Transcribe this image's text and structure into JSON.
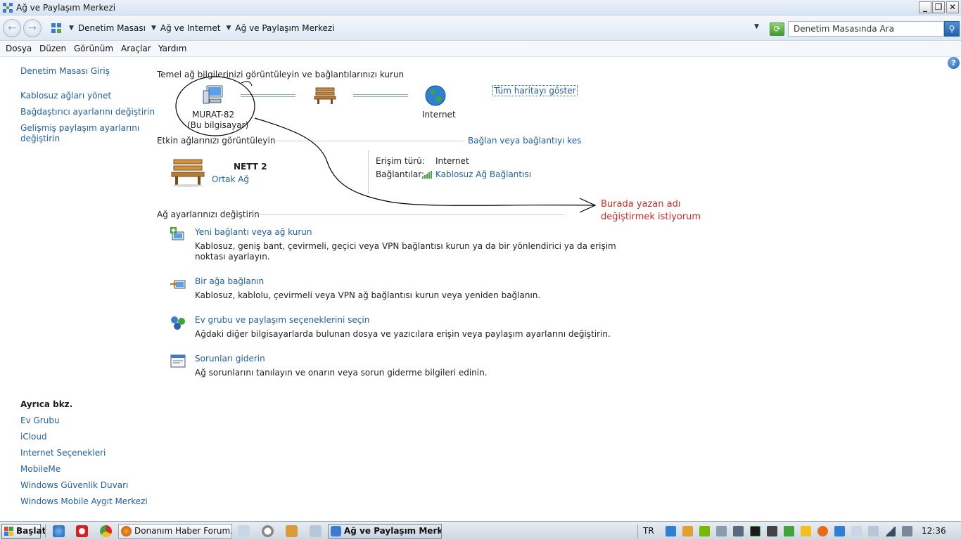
{
  "window": {
    "title": "Ağ ve Paylaşım Merkezi"
  },
  "address": {
    "crumbs": [
      "Denetim Masası",
      "Ağ ve Internet",
      "Ağ ve Paylaşım Merkezi"
    ],
    "search_placeholder": "Denetim Masasında Ara"
  },
  "menu": [
    "Dosya",
    "Düzen",
    "Görünüm",
    "Araçlar",
    "Yardım"
  ],
  "sidebar": {
    "top_links": [
      "Denetim Masası Giriş",
      "Kablosuz ağları yönet",
      "Bağdaştırıcı ayarlarını değiştirin",
      "Gelişmiş paylaşım ayarlarını",
      "değiştirin"
    ],
    "see_also_title": "Ayrıca bkz.",
    "see_also": [
      "Ev Grubu",
      "iCloud",
      "Internet Seçenekleri",
      "MobileMe",
      "Windows Güvenlik Duvarı",
      "Windows Mobile Aygıt Merkezi"
    ]
  },
  "main": {
    "basic_heading": "Temel ağ bilgilerinizi görüntüleyin ve bağlantılarınızı kurun",
    "computer_name": "MURAT-82",
    "computer_sub": "(Bu bilgisayar)",
    "internet_label": "Internet",
    "full_map": "Tüm haritayı göster",
    "active_heading": "Etkin ağlarınızı görüntüleyin",
    "connect_link": "Bağlan veya bağlantıyı kes",
    "network_name": "NETT  2",
    "network_type": "Ortak Ağ",
    "access_label": "Erişim türü:",
    "access_value": "Internet",
    "connections_label": "Bağlantılar:",
    "connections_value": "Kablosuz Ağ Bağlantısı",
    "change_heading": "Ağ ayarlarınızı değiştirin",
    "tasks": [
      {
        "title": "Yeni bağlantı veya ağ kurun",
        "desc1": "Kablosuz, geniş bant, çevirmeli, geçici veya VPN bağlantısı kurun ya da bir yönlendirici ya da erişim",
        "desc2": "noktası ayarlayın."
      },
      {
        "title": "Bir ağa bağlanın",
        "desc1": "Kablosuz, kablolu, çevirmeli veya VPN ağ bağlantısı kurun veya yeniden bağlanın.",
        "desc2": ""
      },
      {
        "title": "Ev grubu ve paylaşım seçeneklerini seçin",
        "desc1": "Ağdaki diğer bilgisayarlarda bulunan dosya ve yazıcılara erişin veya paylaşım ayarlarını değiştirin.",
        "desc2": ""
      },
      {
        "title": "Sorunları giderin",
        "desc1": "Ağ sorunlarını tanılayın ve onarın veya sorun giderme bilgileri edinin.",
        "desc2": ""
      }
    ]
  },
  "annotation": {
    "line1": "Burada yazan adı",
    "line2": "değiştirmek istiyorum"
  },
  "taskbar": {
    "start": "Başlat",
    "tasks": [
      "Donanım Haber Forum...",
      "Ağ ve Paylaşım Merkezi"
    ],
    "lang": "TR",
    "clock": "12:36"
  }
}
